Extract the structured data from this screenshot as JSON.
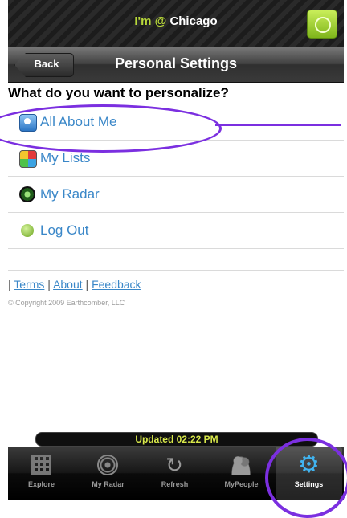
{
  "status_bar": {
    "location_prefix": "I'm",
    "at_symbol": "@",
    "location": "Chicago",
    "gps_icon": "locate-icon"
  },
  "navbar": {
    "back_label": "Back",
    "title": "Personal Settings"
  },
  "content": {
    "question": "What do you want to personalize?",
    "items": [
      {
        "label": "All About Me",
        "icon": "person-card-icon"
      },
      {
        "label": "My Lists",
        "icon": "lists-icon"
      },
      {
        "label": "My Radar",
        "icon": "radar-icon"
      },
      {
        "label": "Log Out",
        "icon": "logout-icon"
      }
    ],
    "footer": {
      "sep1": "|",
      "terms": "Terms",
      "sep2": "|",
      "about": "About",
      "sep3": "|",
      "feedback": "Feedback",
      "copyright": "© Copyright 2009 Earthcomber, LLC"
    }
  },
  "updated_banner": "Updated 02:22 PM",
  "tabbar": {
    "tabs": [
      {
        "label": "Explore",
        "icon": "explore-grid-icon"
      },
      {
        "label": "My Radar",
        "icon": "radar-icon"
      },
      {
        "label": "Refresh",
        "icon": "refresh-icon"
      },
      {
        "label": "MyPeople",
        "icon": "people-icon"
      },
      {
        "label": "Settings",
        "icon": "gear-icon",
        "active": true
      }
    ]
  },
  "colors": {
    "link": "#3a87c8",
    "accent_green": "#b8d83a",
    "annotation": "#7b2fe0",
    "settings_icon": "#41b4f0"
  }
}
